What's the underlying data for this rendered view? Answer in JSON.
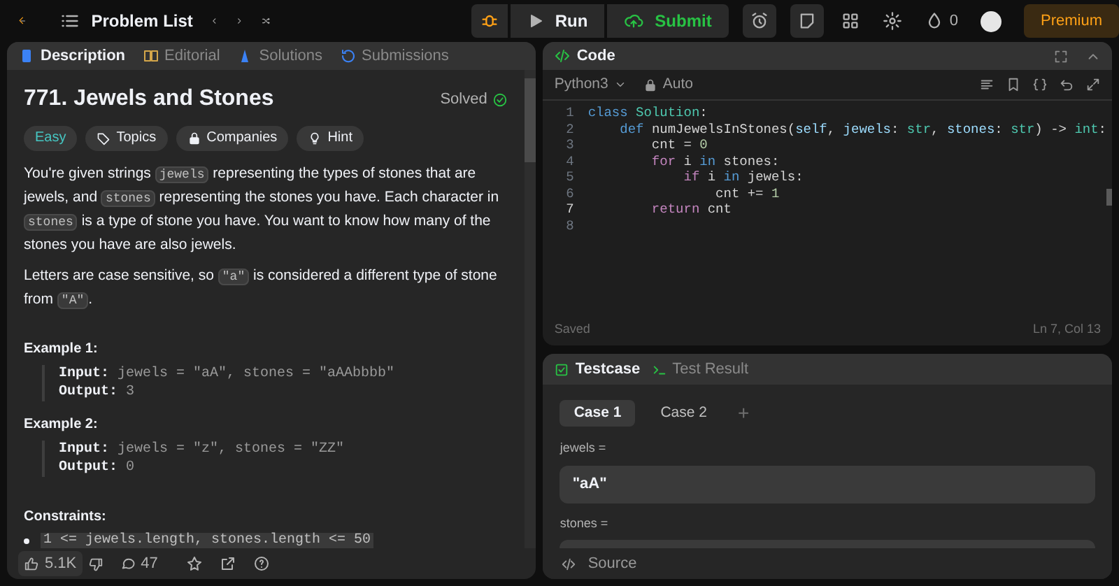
{
  "topbar": {
    "nav_label": "Problem List",
    "run": "Run",
    "submit": "Submit",
    "streak": "0",
    "premium": "Premium"
  },
  "description_tabs": [
    {
      "label": "Description",
      "selected": true
    },
    {
      "label": "Editorial",
      "selected": false
    },
    {
      "label": "Solutions",
      "selected": false
    },
    {
      "label": "Submissions",
      "selected": false
    }
  ],
  "problem": {
    "title": "771. Jewels and Stones",
    "status": "Solved",
    "difficulty": "Easy",
    "tags": [
      "Topics",
      "Companies",
      "Hint"
    ],
    "paragraphs": [
      [
        {
          "kind": "text",
          "text": "You're given strings "
        },
        {
          "kind": "code",
          "text": "jewels"
        },
        {
          "kind": "text",
          "text": " representing the types of stones that are jewels, and "
        },
        {
          "kind": "code",
          "text": "stones"
        },
        {
          "kind": "text",
          "text": " representing the stones you have. Each character in "
        },
        {
          "kind": "code",
          "text": "stones"
        },
        {
          "kind": "text",
          "text": " is a type of stone you have. You want to know how many of the stones you have are also jewels."
        }
      ],
      [
        {
          "kind": "text",
          "text": "Letters are case sensitive, so "
        },
        {
          "kind": "code",
          "text": "\"a\""
        },
        {
          "kind": "text",
          "text": " is considered a different type of stone from "
        },
        {
          "kind": "code",
          "text": "\"A\""
        },
        {
          "kind": "text",
          "text": "."
        }
      ]
    ],
    "examples": [
      {
        "title": "Example 1:",
        "input_label": "Input:",
        "input": "jewels = \"aA\", stones = \"aAAbbbb\"",
        "output_label": "Output:",
        "output": "3"
      },
      {
        "title": "Example 2:",
        "input_label": "Input:",
        "input": "jewels = \"z\", stones = \"ZZ\"",
        "output_label": "Output:",
        "output": "0"
      }
    ],
    "constraints_title": "Constraints:",
    "constraints": [
      "1 <= jewels.length, stones.length <= 50"
    ]
  },
  "footer": {
    "likes": "5.1K",
    "comments": "47"
  },
  "code_panel": {
    "title": "Code",
    "language": "Python3",
    "mode": "Auto",
    "status": "Saved",
    "cursor": "Ln 7, Col 13",
    "lines": [
      {
        "number": "1",
        "tokens": [
          {
            "kind": "keyword",
            "text": "class"
          },
          {
            "kind": "type",
            "text": " Solution"
          },
          {
            "kind": "plain",
            "text": ":"
          }
        ]
      },
      {
        "number": "2",
        "tokens": [
          {
            "kind": "keyword",
            "text": "    def"
          },
          {
            "kind": "plain",
            "text": " numJewelsInStones("
          },
          {
            "kind": "param",
            "text": "self"
          },
          {
            "kind": "plain",
            "text": ", "
          },
          {
            "kind": "param",
            "text": "jewels"
          },
          {
            "kind": "plain",
            "text": ": "
          },
          {
            "kind": "type",
            "text": "str"
          },
          {
            "kind": "plain",
            "text": ", "
          },
          {
            "kind": "param",
            "text": "stones"
          },
          {
            "kind": "plain",
            "text": ": "
          },
          {
            "kind": "type",
            "text": "str"
          },
          {
            "kind": "plain",
            "text": ") -> "
          },
          {
            "kind": "type",
            "text": "int"
          },
          {
            "kind": "plain",
            "text": ":"
          }
        ]
      },
      {
        "number": "3",
        "tokens": [
          {
            "kind": "plain",
            "text": "        cnt = "
          },
          {
            "kind": "number",
            "text": "0"
          }
        ]
      },
      {
        "number": "4",
        "tokens": [
          {
            "kind": "control",
            "text": "        for"
          },
          {
            "kind": "plain",
            "text": " i "
          },
          {
            "kind": "keyword",
            "text": "in"
          },
          {
            "kind": "plain",
            "text": " stones:"
          }
        ]
      },
      {
        "number": "5",
        "tokens": [
          {
            "kind": "control",
            "text": "            if"
          },
          {
            "kind": "plain",
            "text": " i "
          },
          {
            "kind": "keyword",
            "text": "in"
          },
          {
            "kind": "plain",
            "text": " jewels:"
          }
        ]
      },
      {
        "number": "6",
        "tokens": [
          {
            "kind": "plain",
            "text": "                cnt += "
          },
          {
            "kind": "number",
            "text": "1"
          }
        ]
      },
      {
        "number": "7",
        "current": true,
        "tokens": [
          {
            "kind": "control",
            "text": "        return"
          },
          {
            "kind": "plain",
            "text": " cnt"
          }
        ]
      },
      {
        "number": "8",
        "current": false
      }
    ]
  },
  "testcase_panel": {
    "tabs": [
      {
        "label": "Testcase",
        "selected": true
      },
      {
        "label": "Test Result",
        "selected": false
      }
    ],
    "cases": [
      {
        "label": "Case 1",
        "selected": true
      },
      {
        "label": "Case 2",
        "selected": false
      }
    ],
    "add": "+",
    "params": [
      {
        "label": "jewels =",
        "value": "\"aA\""
      },
      {
        "label": "stones ="
      }
    ],
    "source": "Source"
  }
}
